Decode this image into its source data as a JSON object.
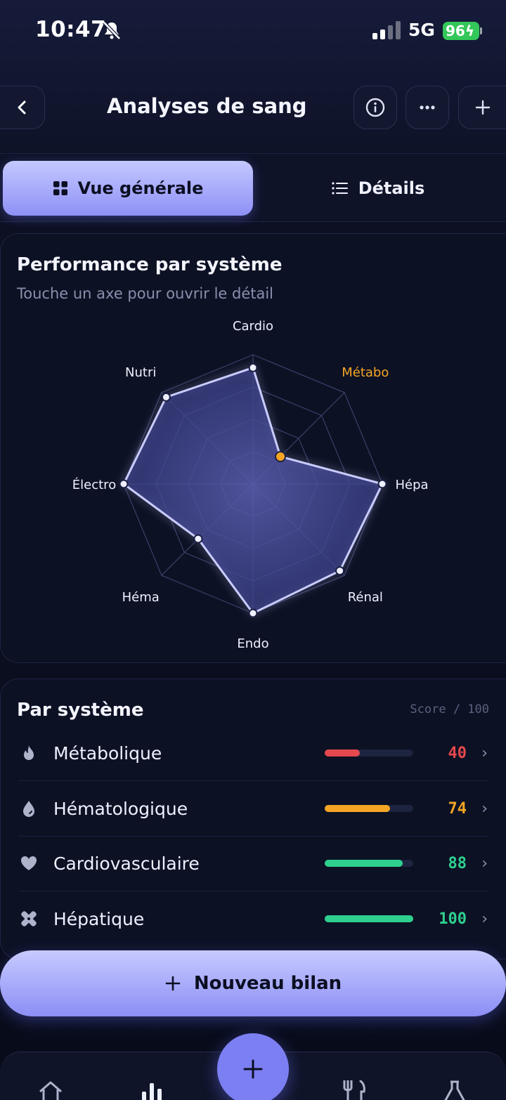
{
  "status_bar": {
    "time": "10:47",
    "network": "5G",
    "battery": "96"
  },
  "header": {
    "title": "Analyses de sang"
  },
  "segments": {
    "active_label": "Vue générale",
    "inactive_label": "Détails"
  },
  "performance": {
    "title": "Performance par système",
    "subtitle": "Touche un axe pour ouvrir le détail"
  },
  "chart_data": {
    "type": "radar",
    "axes": [
      "Cardio",
      "Métabo",
      "Hépa",
      "Rénal",
      "Endo",
      "Héma",
      "Électro",
      "Nutri"
    ],
    "values": [
      90,
      30,
      100,
      95,
      100,
      60,
      100,
      95
    ],
    "max": 100,
    "highlighted_axis": "Métabo",
    "colors": {
      "series": "#c9ccff",
      "highlight": "#f5a524",
      "grid": "#3a4168"
    }
  },
  "systems": {
    "title": "Par système",
    "score_hint": "Score / 100",
    "items": [
      {
        "label": "Métabolique",
        "icon": "flame-icon",
        "score": "40",
        "value": 40,
        "color": "#e5484d"
      },
      {
        "label": "Hématologique",
        "icon": "drop-icon",
        "score": "74",
        "value": 74,
        "color": "#f5a524"
      },
      {
        "label": "Cardiovasculaire",
        "icon": "heart-icon",
        "score": "88",
        "value": 88,
        "color": "#2fd08f"
      },
      {
        "label": "Hépatique",
        "icon": "bandage-icon",
        "score": "100",
        "value": 100,
        "color": "#2fd08f"
      }
    ]
  },
  "cta": {
    "label": "Nouveau bilan"
  }
}
